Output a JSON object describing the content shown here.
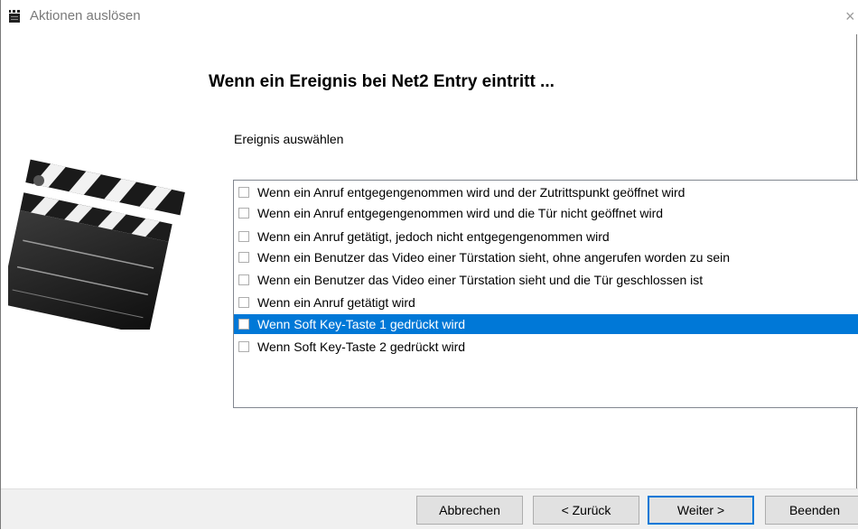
{
  "window": {
    "title": "Aktionen auslösen",
    "close_glyph": "×"
  },
  "heading": "Wenn ein Ereignis bei Net2 Entry eintritt ...",
  "event_label": "Ereignis auswählen",
  "events": [
    {
      "label": "Wenn ein Anruf entgegengenommen wird und der Zutrittspunkt geöffnet wird",
      "checked": false,
      "selected": false
    },
    {
      "label": "Wenn ein Anruf entgegengenommen wird und die Tür nicht geöffnet wird",
      "checked": false,
      "selected": false
    },
    {
      "label": "Wenn ein Anruf getätigt, jedoch nicht entgegengenommen wird",
      "checked": false,
      "selected": false
    },
    {
      "label": "Wenn ein Benutzer das Video einer Türstation sieht, ohne angerufen worden zu sein",
      "checked": false,
      "selected": false
    },
    {
      "label": "Wenn ein Benutzer das Video einer Türstation sieht und die Tür geschlossen ist",
      "checked": false,
      "selected": false
    },
    {
      "label": "Wenn ein Anruf getätigt wird",
      "checked": false,
      "selected": false
    },
    {
      "label": "Wenn Soft Key-Taste 1 gedrückt wird",
      "checked": false,
      "selected": true
    },
    {
      "label": "Wenn Soft Key-Taste 2 gedrückt wird",
      "checked": false,
      "selected": false
    }
  ],
  "buttons": {
    "cancel": "Abbrechen",
    "back": "< Zurück",
    "next": "Weiter >",
    "finish": "Beenden"
  },
  "icons": {
    "app": "clapperboard-icon",
    "illustration": "clapperboard-illustration"
  },
  "colors": {
    "selection": "#0078d7",
    "default_button_border": "#0078d7",
    "footer_bg": "#f0f0f0"
  }
}
